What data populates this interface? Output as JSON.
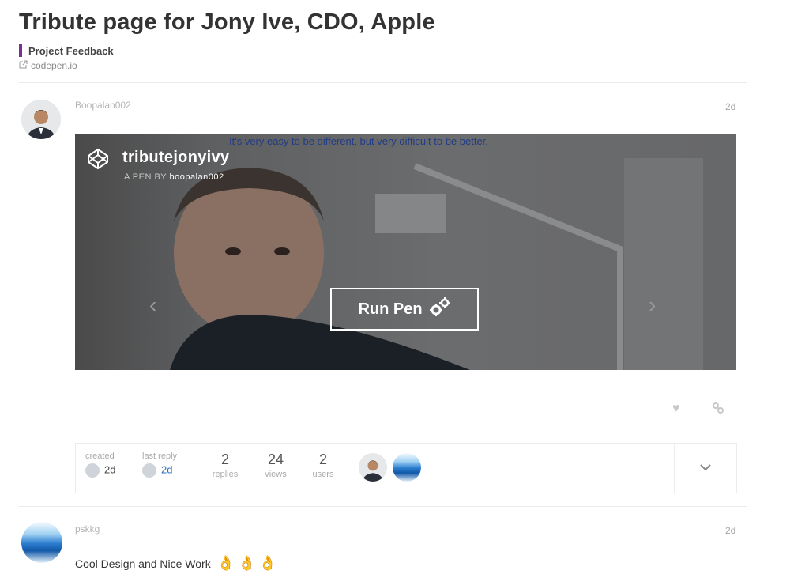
{
  "topic": {
    "title": "Tribute page for Jony Ive, CDO, Apple",
    "category": "Project Feedback",
    "link": "codepen.io",
    "colors": {
      "category": "#7b2f8e"
    }
  },
  "post1": {
    "username": "Boopalan002",
    "date": "2d",
    "quote": "It's very easy to be different, but very difficult to be better.",
    "onebox": {
      "pen_name": "tributejonyivy",
      "by_label": "A PEN BY",
      "author": "boopalan002",
      "run_label": "Run Pen"
    }
  },
  "summary": {
    "created_label": "created",
    "created_value": "2d",
    "last_reply_label": "last reply",
    "last_reply_value": "2d",
    "replies": "2",
    "replies_label": "replies",
    "views": "24",
    "views_label": "views",
    "users": "2",
    "users_label": "users"
  },
  "post2": {
    "username": "pskkg",
    "date": "2d",
    "text": "Cool Design and Nice Work"
  }
}
